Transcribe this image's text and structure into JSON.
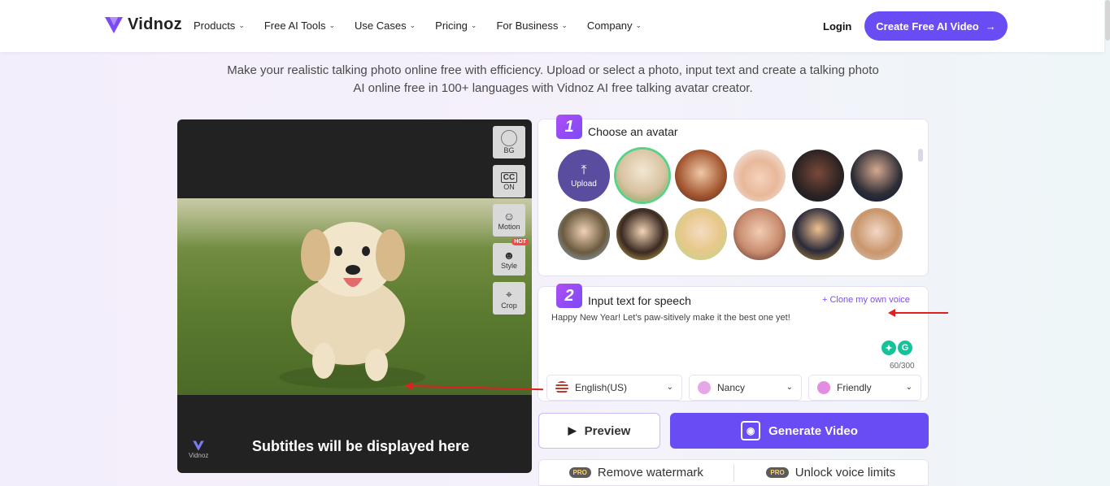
{
  "nav": {
    "logo": "Vidnoz",
    "items": [
      {
        "label": "Products"
      },
      {
        "label": "Free AI Tools"
      },
      {
        "label": "Use Cases"
      },
      {
        "label": "Pricing"
      },
      {
        "label": "For Business"
      },
      {
        "label": "Company"
      }
    ],
    "login": "Login",
    "cta": "Create Free AI Video",
    "cta_arrow": "→"
  },
  "hero": {
    "subtitle_line1": "Make your realistic talking photo online free with efficiency. Upload or select a photo, input text and create a talking photo",
    "subtitle_line2": "AI online free in 100+ languages with Vidnoz AI free talking avatar creator."
  },
  "video": {
    "tools": [
      {
        "label": "BG",
        "icon": "circle-icon"
      },
      {
        "label": "ON",
        "icon": "cc-icon"
      },
      {
        "label": "Motion",
        "icon": "motion-icon"
      },
      {
        "label": "Style",
        "icon": "style-icon",
        "badge": "HOT"
      },
      {
        "label": "Crop",
        "icon": "crop-icon"
      }
    ],
    "subtitles_placeholder": "Subtitles will be displayed here",
    "watermark": "Vidnoz"
  },
  "step1": {
    "number": "1",
    "title": "Choose an avatar",
    "upload_label": "Upload"
  },
  "step2": {
    "number": "2",
    "title": "Input text for speech",
    "clone": "+ Clone my own voice",
    "text": "Happy New Year! Let's paw-sitively make it the best one yet!",
    "counter": "60/300",
    "language": "English(US)",
    "voice": "Nancy",
    "style": "Friendly"
  },
  "actions": {
    "preview": "Preview",
    "generate": "Generate Video"
  },
  "promo": {
    "badge": "PRO",
    "watermark": "Remove watermark",
    "voice": "Unlock voice limits"
  },
  "colors": {
    "accent": "#6a4cf5",
    "selected_ring": "#5bd187",
    "annotation_arrow": "#e02020"
  }
}
